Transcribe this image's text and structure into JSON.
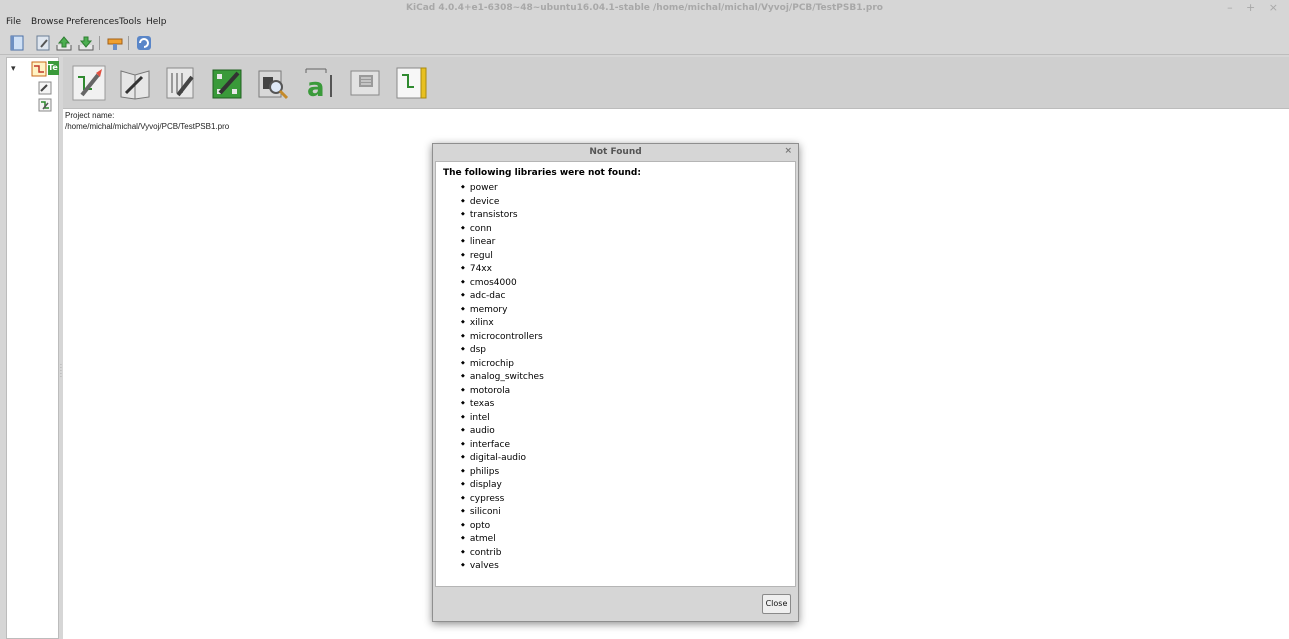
{
  "window": {
    "title": "KiCad 4.0.4+e1-6308~48~ubuntu16.04.1-stable /home/michal/michal/Vyvoj/PCB/TestPSB1.pro",
    "controls": "– + ×"
  },
  "menu": [
    "File",
    "Browse",
    "Preferences",
    "Tools",
    "Help"
  ],
  "toolbar": {
    "icons": [
      "new-project-icon",
      "open-project-icon",
      "save-project-icon",
      "archive-icon",
      "unarchive-icon",
      "editor-icon",
      "refresh-icon"
    ]
  },
  "tree": {
    "root_label": "Te",
    "expander": "▾",
    "children": [
      "schematic-file-icon",
      "pcb-file-icon"
    ]
  },
  "launcher": {
    "buttons": [
      "Eeschema",
      "Schematic library editor",
      "Pcbnew",
      "Footprint editor",
      "Gerbview",
      "Bitmap2Component",
      "Pcb calculator",
      "Pl editor"
    ]
  },
  "project": {
    "label": "Project name:",
    "path": "/home/michal/michal/Vyvoj/PCB/TestPSB1.pro"
  },
  "dialog": {
    "title": "Not Found",
    "close_glyph": "×",
    "heading": "The following libraries were not found:",
    "libraries": [
      "power",
      "device",
      "transistors",
      "conn",
      "linear",
      "regul",
      "74xx",
      "cmos4000",
      "adc-dac",
      "memory",
      "xilinx",
      "microcontrollers",
      "dsp",
      "microchip",
      "analog_switches",
      "motorola",
      "texas",
      "intel",
      "audio",
      "interface",
      "digital-audio",
      "philips",
      "display",
      "cypress",
      "siliconi",
      "opto",
      "atmel",
      "contrib",
      "valves"
    ],
    "close_button": "Close"
  },
  "colors": {
    "window_bg": "#d6d6d6",
    "panel_bg": "#ffffff",
    "accent_green": "#3a9a3a",
    "accent_yellow": "#e8c020"
  }
}
